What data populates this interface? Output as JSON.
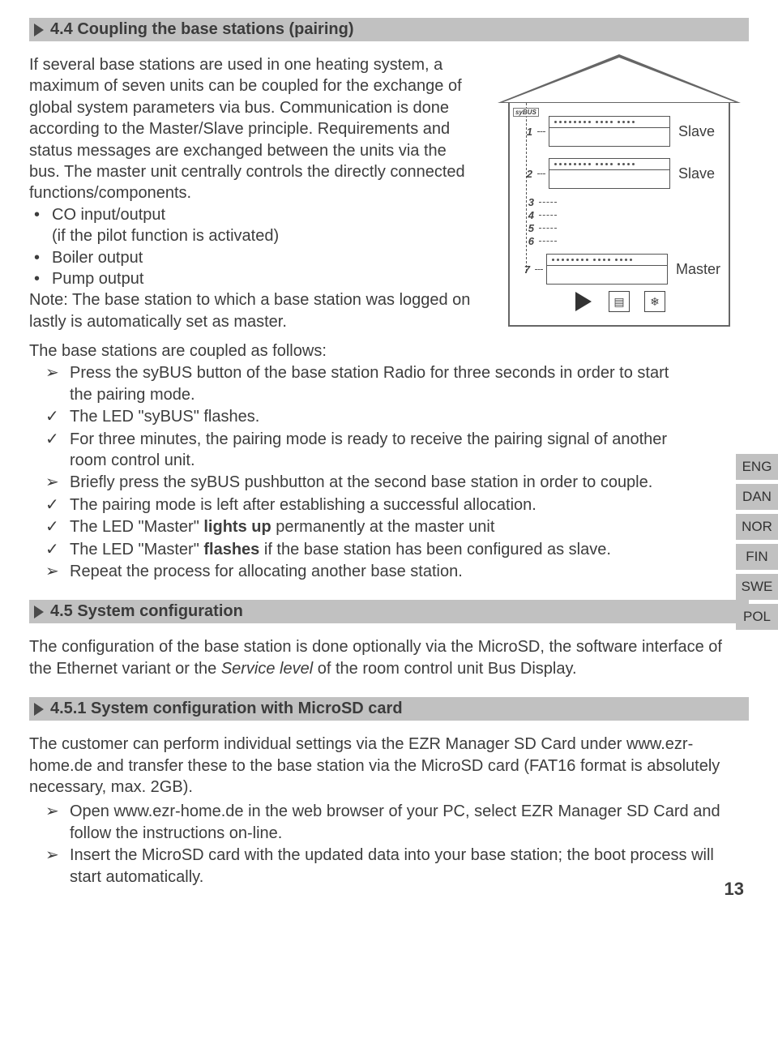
{
  "sect44": {
    "title": "4.4 Coupling the base stations (pairing)",
    "p1": "If several base stations are used in one heating system, a maximum of seven units can be coupled for the exchange of global system parameters via bus. Communication is done according to the Master/Slave principle. Requirements and status messages are exchanged between the units via the bus. The master unit centrally controls the directly connected functions/components.",
    "b1": "CO input/output",
    "b1sub": "(if the pilot function is activated)",
    "b2": "Boiler output",
    "b3": "Pump output",
    "note": "Note: The base station to which a base station was logged on lastly is automatically set as master.",
    "procIntro": "The base stations are coupled as follows:",
    "s1": "Press the syBUS button of the base station Radio for three seconds in order to start the pairing mode.",
    "s2": "The LED \"syBUS\" flashes.",
    "s3": "For three minutes, the pairing mode is ready to receive the pairing signal of another room control unit.",
    "s4": "Briefly press the syBUS pushbutton at the second base station in order to couple.",
    "s5": "The pairing mode is left after establishing a successful allocation.",
    "s6a": "The LED \"Master\" ",
    "s6b": "lights up",
    "s6c": " permanently at the master unit",
    "s7a": "The LED \"Master\" ",
    "s7b": "flashes",
    "s7c": " if the base station has been configured as slave.",
    "s8": "Repeat the process for allocating another base station."
  },
  "sect45": {
    "title": "4.5 System configuration",
    "p1a": "The configuration of the base station is done optionally via the MicroSD, the software interface of the Ethernet variant or the ",
    "p1b": "Service level",
    "p1c": " of the room control unit Bus Display."
  },
  "sect451": {
    "title": "4.5.1 System configuration with MicroSD card",
    "p1": "The customer can perform individual settings via the EZR Manager SD Card under www.ezr-home.de and transfer these to the base station via the MicroSD card (FAT16 format is absolutely necessary, max. 2GB).",
    "s1": "Open www.ezr-home.de in the web browser of your PC, select EZR Manager SD Card and follow the instructions on-line.",
    "s2": "Insert the MicroSD card with the updated data into your base station; the boot process will start automatically."
  },
  "diagram": {
    "sybus": "syBUS",
    "n1": "1",
    "n2": "2",
    "n3": "3",
    "n4": "4",
    "n5": "5",
    "n6": "6",
    "n7": "7",
    "slave": "Slave",
    "master": "Master"
  },
  "lang": {
    "eng": "ENG",
    "dan": "DAN",
    "nor": "NOR",
    "fin": "FIN",
    "swe": "SWE",
    "pol": "POL"
  },
  "pageNum": "13"
}
